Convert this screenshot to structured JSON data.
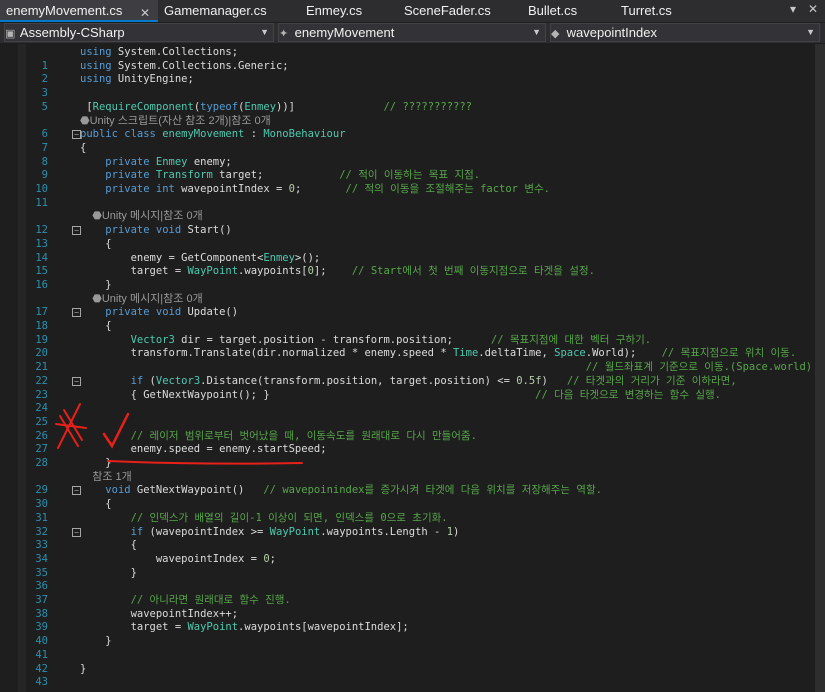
{
  "tabs": [
    {
      "label": "enemyMovement.cs",
      "active": true
    },
    {
      "label": "Gamemanager.cs"
    },
    {
      "label": "Enmey.cs"
    },
    {
      "label": "SceneFader.cs"
    },
    {
      "label": "Bullet.cs"
    },
    {
      "label": "Turret.cs"
    }
  ],
  "tab_close_glyph": "✕",
  "tab_dropdown_glyph": "▾",
  "nav": {
    "project": "Assembly-CSharp",
    "class": "enemyMovement",
    "member": "wavepointIndex"
  },
  "code_lines": [
    {
      "n": "",
      "html": "<span class=\"kw\">using</span> System.Collections;"
    },
    {
      "n": "1",
      "html": "<span class=\"kw\">using</span> System.Collections.Generic;"
    },
    {
      "n": "2",
      "html": "<span class=\"kw\">using</span> UnityEngine;"
    },
    {
      "n": "3",
      "html": ""
    },
    {
      "n": "5",
      "html": " [<span class=\"ty\">RequireComponent</span>(<span class=\"kw\">typeof</span>(<span class=\"ty\">Enmey</span>))]              <span class=\"cm\">// ???????????</span>"
    },
    {
      "n": "",
      "lens": "⬣Unity 스크립트(자산 참조 2개)|참조 0개"
    },
    {
      "n": "6",
      "html": "<span class=\"kw\">public class</span> <span class=\"ty\">enemyMovement</span> : <span class=\"ty\">MonoBehaviour</span>"
    },
    {
      "n": "7",
      "html": "{"
    },
    {
      "n": "8",
      "html": "    <span class=\"kw\">private</span> <span class=\"ty\">Enmey</span> enemy;"
    },
    {
      "n": "9",
      "html": "    <span class=\"kw\">private</span> <span class=\"ty\">Transform</span> target;            <span class=\"cm\">// 적이 이동하는 목표 지점.</span>"
    },
    {
      "n": "10",
      "html": "    <span class=\"kw\">private int</span> wavepointIndex = <span class=\"num\">0</span>;       <span class=\"cm\">// 적의 이동을 조절해주는 factor 변수.</span>"
    },
    {
      "n": "11",
      "html": ""
    },
    {
      "n": "",
      "lens": "    ⬣Unity 메시지|참조 0개"
    },
    {
      "n": "12",
      "html": "    <span class=\"kw\">private void</span> Start()"
    },
    {
      "n": "13",
      "html": "    {"
    },
    {
      "n": "14",
      "html": "        enemy = GetComponent&lt;<span class=\"ty\">Enmey</span>&gt;();"
    },
    {
      "n": "15",
      "html": "        target = <span class=\"ty\">WayPoint</span>.waypoints[<span class=\"num\">0</span>];    <span class=\"cm\">// Start에서 첫 번째 이동지점으로 타겟을 설정.</span>"
    },
    {
      "n": "16",
      "html": "    }"
    },
    {
      "n": "",
      "lens": "    ⬣Unity 메시지|참조 0개"
    },
    {
      "n": "17",
      "html": "    <span class=\"kw\">private void</span> Update()"
    },
    {
      "n": "18",
      "html": "    {"
    },
    {
      "n": "19",
      "html": "        <span class=\"ty\">Vector3</span> dir = target.position - transform.position;      <span class=\"cm\">// 목표지점에 대한 벡터 구하기.</span>"
    },
    {
      "n": "20",
      "html": "        transform.Translate(dir.normalized * enemy.speed * <span class=\"ty\">Time</span>.deltaTime, <span class=\"ty\">Space</span>.World);    <span class=\"cm\">// 목표지점으로 위치 이동.</span>"
    },
    {
      "n": "21",
      "html": "                                                                                <span class=\"cm\">// 월드좌표계 기준으로 이동.(Space.world)</span>"
    },
    {
      "n": "22",
      "html": "        <span class=\"kw\">if</span> (<span class=\"ty\">Vector3</span>.Distance(transform.position, target.position) &lt;= <span class=\"num\">0.5f</span>)   <span class=\"cm\">// 타겟과의 거리가 기준 이하라면,</span>"
    },
    {
      "n": "23",
      "html": "        { GetNextWaypoint(); }                                          <span class=\"cm\">// 다음 타겟으로 변경하는 함수 실행.</span>"
    },
    {
      "n": "24",
      "html": ""
    },
    {
      "n": "25",
      "html": ""
    },
    {
      "n": "26",
      "html": "        <span class=\"cm\">// 레이저 범위로부터 벗어났을 때, 이동속도를 원래대로 다시 만들어줌.</span>"
    },
    {
      "n": "27",
      "html": "        enemy.speed = enemy.startSpeed;"
    },
    {
      "n": "28",
      "html": "    }"
    },
    {
      "n": "",
      "lens": "    참조 1개"
    },
    {
      "n": "29",
      "html": "    <span class=\"kw\">void</span> GetNextWaypoint()   <span class=\"cm\">// wavepoinindex를 증가시켜 타겟에 다음 위치를 저장해주는 역할.</span>"
    },
    {
      "n": "30",
      "html": "    {"
    },
    {
      "n": "31",
      "html": "        <span class=\"cm\">// 인덱스가 배열의 길이-1 이상이 되면, 인덱스를 0으로 초기화.</span>"
    },
    {
      "n": "32",
      "html": "        <span class=\"kw\">if</span> (wavepointIndex &gt;= <span class=\"ty\">WayPoint</span>.waypoints.Length - <span class=\"num\">1</span>)"
    },
    {
      "n": "33",
      "html": "        {"
    },
    {
      "n": "34",
      "html": "            wavepointIndex = <span class=\"num\">0</span>;"
    },
    {
      "n": "35",
      "html": "        }"
    },
    {
      "n": "36",
      "html": ""
    },
    {
      "n": "37",
      "html": "        <span class=\"cm\">// 아니라면 원래대로 함수 진행.</span>"
    },
    {
      "n": "38",
      "html": "        wavepointIndex++;"
    },
    {
      "n": "39",
      "html": "        target = <span class=\"ty\">WayPoint</span>.waypoints[wavepointIndex];"
    },
    {
      "n": "40",
      "html": "    }"
    },
    {
      "n": "41",
      "html": ""
    },
    {
      "n": "42",
      "html": "}"
    },
    {
      "n": "43",
      "html": ""
    }
  ],
  "fold_glyph": "−",
  "annotation_color": "#e8201a"
}
